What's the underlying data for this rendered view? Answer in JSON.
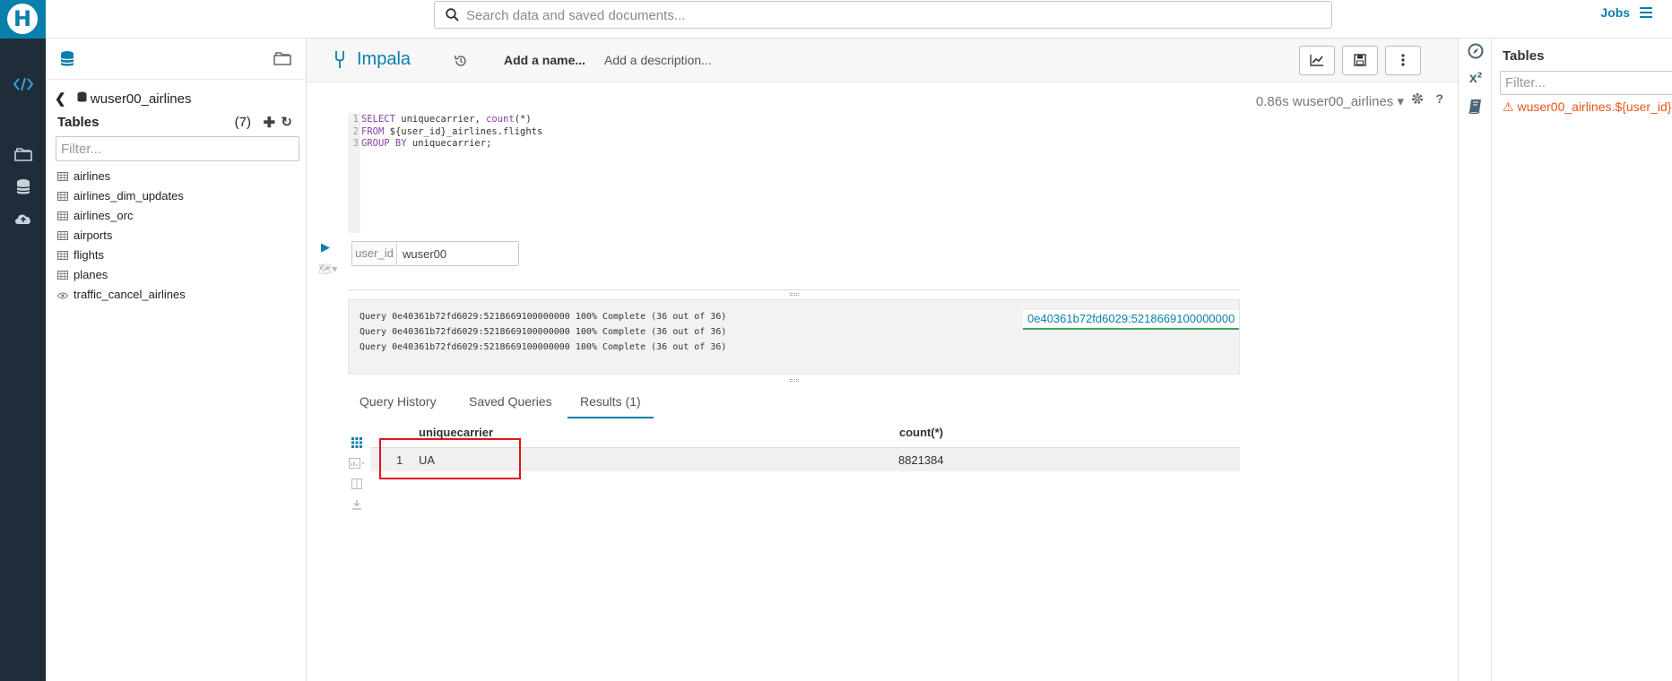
{
  "topbar": {
    "search_placeholder": "Search data and saved documents...",
    "jobs_label": "Jobs"
  },
  "assist": {
    "database": "wuser00_airlines",
    "tables_heading": "Tables",
    "tables_count": "(7)",
    "filter_placeholder": "Filter...",
    "tables": [
      {
        "name": "airlines",
        "kind": "table"
      },
      {
        "name": "airlines_dim_updates",
        "kind": "table"
      },
      {
        "name": "airlines_orc",
        "kind": "table"
      },
      {
        "name": "airports",
        "kind": "table"
      },
      {
        "name": "flights",
        "kind": "table"
      },
      {
        "name": "planes",
        "kind": "table"
      },
      {
        "name": "traffic_cancel_airlines",
        "kind": "view"
      }
    ]
  },
  "snippet": {
    "engine": "Impala",
    "name_placeholder": "Add a name...",
    "description_placeholder": "Add a description...",
    "exec_info": "0.86s wuser00_airlines",
    "code": [
      {
        "num": "1",
        "kw": "SELECT",
        "rest": " uniquecarrier, ",
        "kw2": "count",
        "rest2": "(*)"
      },
      {
        "num": "2",
        "kw": "FROM",
        "rest": " ${user_id}_airlines.flights",
        "kw2": "",
        "rest2": ""
      },
      {
        "num": "3",
        "kw": "GROUP BY",
        "rest": " uniquecarrier;",
        "kw2": "",
        "rest2": ""
      }
    ],
    "param_name": "user_id",
    "param_value": "wuser00"
  },
  "log": {
    "lines": [
      "Query 0e40361b72fd6029:5218669100000000 100% Complete (36 out of 36)",
      "Query 0e40361b72fd6029:5218669100000000 100% Complete (36 out of 36)",
      "Query 0e40361b72fd6029:5218669100000000 100% Complete (36 out of 36)"
    ],
    "query_id": "0e40361b72fd6029:5218669100000000"
  },
  "tabs": [
    {
      "label": "Query History",
      "active": false
    },
    {
      "label": "Saved Queries",
      "active": false
    },
    {
      "label": "Results (1)",
      "active": true
    }
  ],
  "results": {
    "columns": [
      "uniquecarrier",
      "count(*)"
    ],
    "rows": [
      {
        "n": "1",
        "values": [
          "UA",
          "8821384"
        ]
      }
    ]
  },
  "right_assist": {
    "title": "Tables",
    "filter_placeholder": "Filter...",
    "warning": "wuser00_airlines.${user_id}"
  },
  "colors": {
    "accent": "#0b7fab",
    "nav_bg": "#1f2d3a",
    "warning": "#e8541c",
    "highlight_box": "#e3141b"
  }
}
